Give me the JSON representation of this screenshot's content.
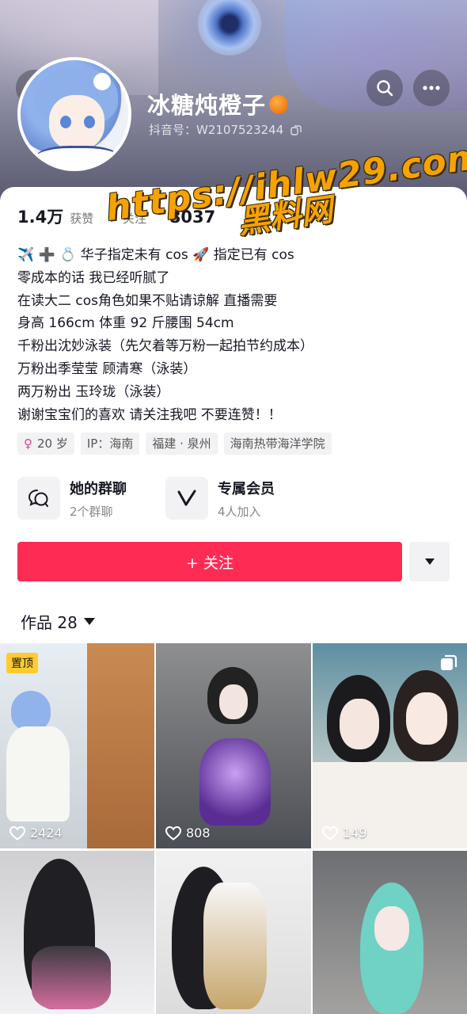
{
  "profile": {
    "name": "冰糖炖橙子",
    "douyin_id": "抖音号：W2107523244"
  },
  "stats": [
    {
      "value": "1.4万",
      "label": "获赞"
    },
    {
      "value": "",
      "label": "关注"
    },
    {
      "value": "8037",
      "label": ""
    }
  ],
  "watermark": {
    "line1": "https://ihlw29.com",
    "line2": "黑料网"
  },
  "bio": [
    "✈️ ➕ 💍 华子指定未有 cos 🚀 指定已有 cos",
    "零成本的话 我已经听腻了",
    "在读大二  cos角色如果不贴请谅解 直播需要",
    "身高 166cm 体重 92 斤腰围 54cm",
    "千粉出沈妙泳装（先欠着等万粉一起拍节约成本）",
    "万粉出季莹莹 顾清寒（泳装）",
    "两万粉出 玉玲珑（泳装）",
    "谢谢宝宝们的喜欢 请关注我吧 不要连赞！！"
  ],
  "tags": {
    "age": "20 岁",
    "ip": "IP：海南",
    "location": "福建 · 泉州",
    "school": "海南热带海洋学院"
  },
  "features": {
    "group_title": "她的群聊",
    "group_sub": "2个群聊",
    "member_title": "专属会员",
    "member_sub": "4人加入"
  },
  "follow_label": "+ 关注",
  "works_label": "作品 28",
  "pinned_label": "置顶",
  "posts": [
    {
      "likes": "2424"
    },
    {
      "likes": "808"
    },
    {
      "likes": "149"
    }
  ],
  "colors": {
    "accent": "#fe2c55",
    "pin": "#fecc2f"
  }
}
